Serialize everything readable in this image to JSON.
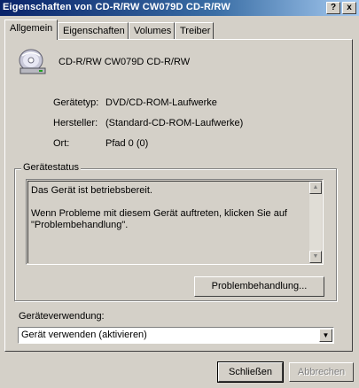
{
  "window": {
    "title": "Eigenschaften von CD-R/RW CW079D CD-R/RW",
    "help_button": "?",
    "close_button": "x"
  },
  "tabs": [
    {
      "label": "Allgemein",
      "active": true
    },
    {
      "label": "Eigenschaften",
      "active": false
    },
    {
      "label": "Volumes",
      "active": false
    },
    {
      "label": "Treiber",
      "active": false
    }
  ],
  "device": {
    "icon": "cd-drive-icon",
    "name": "CD-R/RW CW079D CD-R/RW",
    "properties": [
      {
        "label": "Gerätetyp:",
        "value": "DVD/CD-ROM-Laufwerke"
      },
      {
        "label": "Hersteller:",
        "value": "(Standard-CD-ROM-Laufwerke)"
      },
      {
        "label": "Ort:",
        "value": "Pfad 0 (0)"
      }
    ]
  },
  "status_group": {
    "legend": "Gerätestatus",
    "line1": "Das Gerät ist betriebsbereit.",
    "line2": "Wenn Probleme mit diesem Gerät auftreten, klicken Sie auf \"Problembehandlung\".",
    "troubleshoot_button": "Problembehandlung..."
  },
  "usage": {
    "label": "Geräteverwendung:",
    "selected": "Gerät verwenden (aktivieren)"
  },
  "footer": {
    "close_button": "Schließen",
    "cancel_button": "Abbrechen"
  }
}
